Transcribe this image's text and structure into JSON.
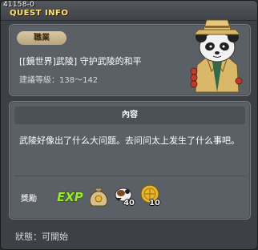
{
  "titlebar": {
    "quest_id": "41158-0",
    "title": "QUEST INFO"
  },
  "quest": {
    "job_badge": "職業",
    "name": "[[鏡世界]武陵] 守护武陵的和平",
    "recommend_level": "建議等級：138～142",
    "content_header": "內容",
    "description": "武陵好像出了什么大问题。去问问太上发生了什么事吧。"
  },
  "rewards": {
    "label": "獎勵",
    "exp_label": "EXP",
    "items": [
      {
        "icon": "money-bag-icon",
        "qty": ""
      },
      {
        "icon": "pet-item-icon",
        "qty": "40"
      },
      {
        "icon": "gold-coin-icon",
        "qty": "10"
      }
    ]
  },
  "status": {
    "text": "狀態：可開始"
  },
  "colors": {
    "window_bg": "#3d4044",
    "panel_bg": "#5b6066",
    "title_yellow": "#ffe27a",
    "exp_green": "#9be834",
    "badge_tan": "#cbb890"
  }
}
